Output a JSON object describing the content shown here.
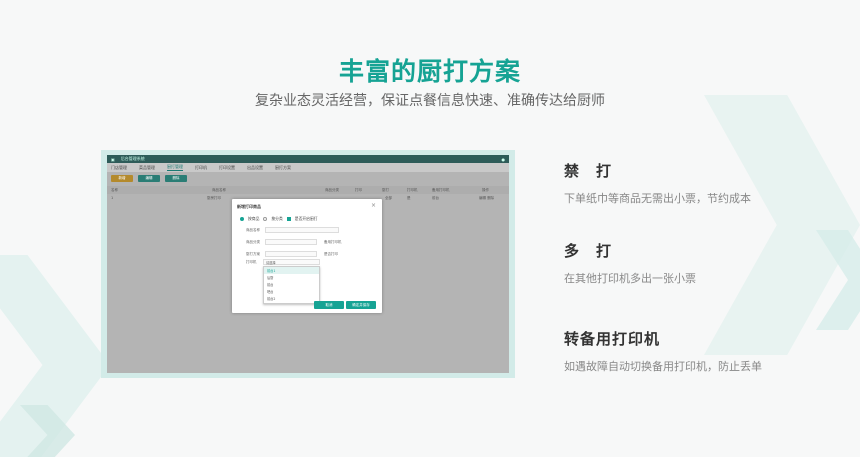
{
  "heading": {
    "title": "丰富的厨打方案",
    "subtitle": "复杂业态灵活经营，保证点餐信息快速、准确传达给厨师"
  },
  "screenshot": {
    "app_title": "后台管理系统",
    "tabs": [
      "门店管理",
      "菜品管理",
      "厨打管理",
      "打印机",
      "打印设置",
      "出品设置",
      "厨打方案"
    ],
    "active_tab_index": 2,
    "toolbar_buttons": [
      "新增",
      "编辑",
      "删除"
    ],
    "table_headers": [
      "名称",
      "商品名称",
      "商品分类",
      "打印",
      "厨打",
      "打印机",
      "备用打印机",
      "操作"
    ],
    "row_values": [
      "1",
      "厨房打印",
      "全部",
      "是",
      "前台",
      "编辑 删除"
    ],
    "modal": {
      "title": "新增打印商品",
      "radio_options": [
        "按商品",
        "按分类"
      ],
      "checkbox_label": "是否开启厨打",
      "fields": [
        {
          "label": "商品名称",
          "value": ""
        },
        {
          "label": "商品分类",
          "value": ""
        },
        {
          "label": "厨打方案",
          "value": ""
        },
        {
          "label": "打印机",
          "value": "请选择"
        },
        {
          "label": "备用打印机",
          "value": ""
        },
        {
          "label": "是否打印",
          "value": ""
        }
      ],
      "dropdown_options": [
        "前台1",
        "后厨",
        "前台",
        "吧台",
        "前台2"
      ],
      "buttons": [
        "取消",
        "确定并保存"
      ]
    }
  },
  "features": [
    {
      "title": "禁　打",
      "desc": "下单纸巾等商品无需出小票，节约成本"
    },
    {
      "title": "多　打",
      "desc": "在其他打印机多出一张小票"
    },
    {
      "title": "转备用打印机",
      "desc": "如遇故障自动切换备用打印机，防止丢单"
    }
  ]
}
